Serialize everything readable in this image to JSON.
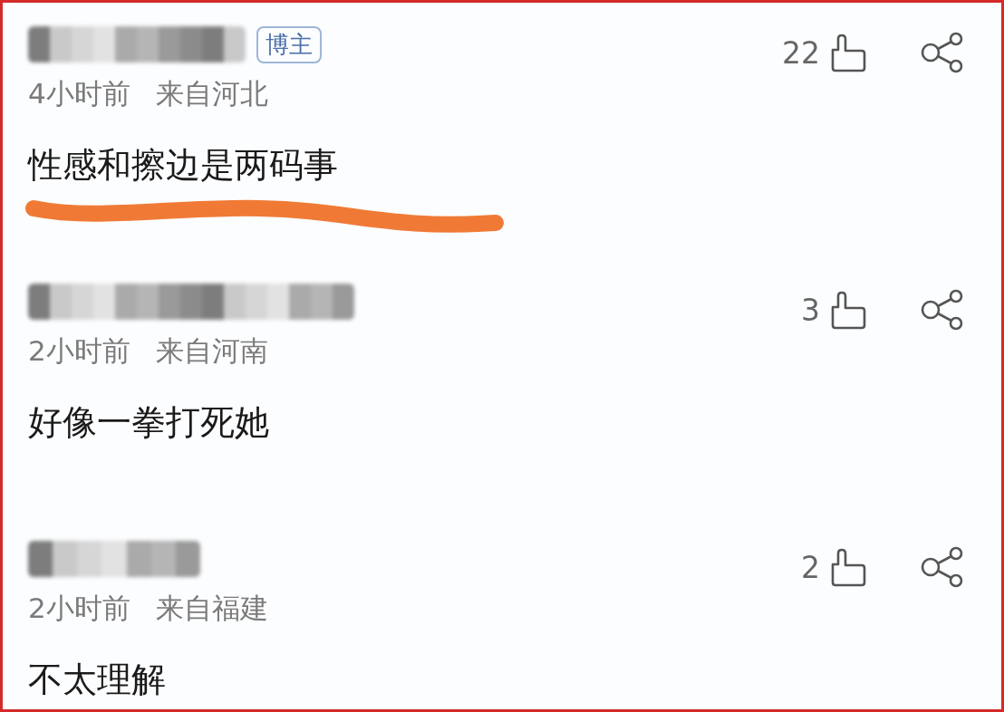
{
  "comments": [
    {
      "badge": "博主",
      "time": "4小时前",
      "location": "来自河北",
      "text": "性感和擦边是两码事",
      "likes": "22",
      "underlined": true
    },
    {
      "time": "2小时前",
      "location": "来自河南",
      "text": "好像一拳打死她",
      "likes": "3",
      "underlined": false
    },
    {
      "time": "2小时前",
      "location": "来自福建",
      "text": "不太理解",
      "likes": "2",
      "underlined": false
    }
  ]
}
